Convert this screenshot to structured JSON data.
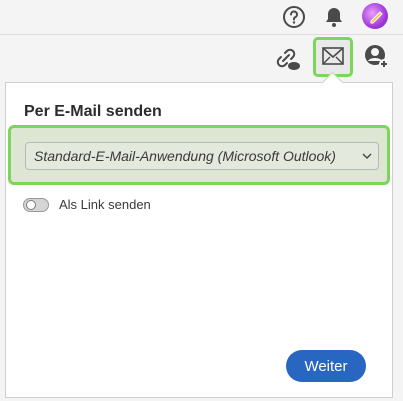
{
  "header": {
    "help_icon": "help-circle-icon",
    "bell_icon": "bell-icon",
    "avatar_icon": "avatar"
  },
  "toolbar": {
    "link_icon": "link-cloud-icon",
    "mail_icon": "mail-icon",
    "user_add_icon": "user-add-icon",
    "highlight_color": "#7cd65a"
  },
  "panel": {
    "title": "Per E-Mail senden",
    "email_app_select": "Standard-E-Mail-Anwendung (Microsoft Outlook)",
    "toggle_label": "Als Link senden",
    "toggle_on": false,
    "next_button": "Weiter",
    "accent_color": "#2966c2"
  }
}
